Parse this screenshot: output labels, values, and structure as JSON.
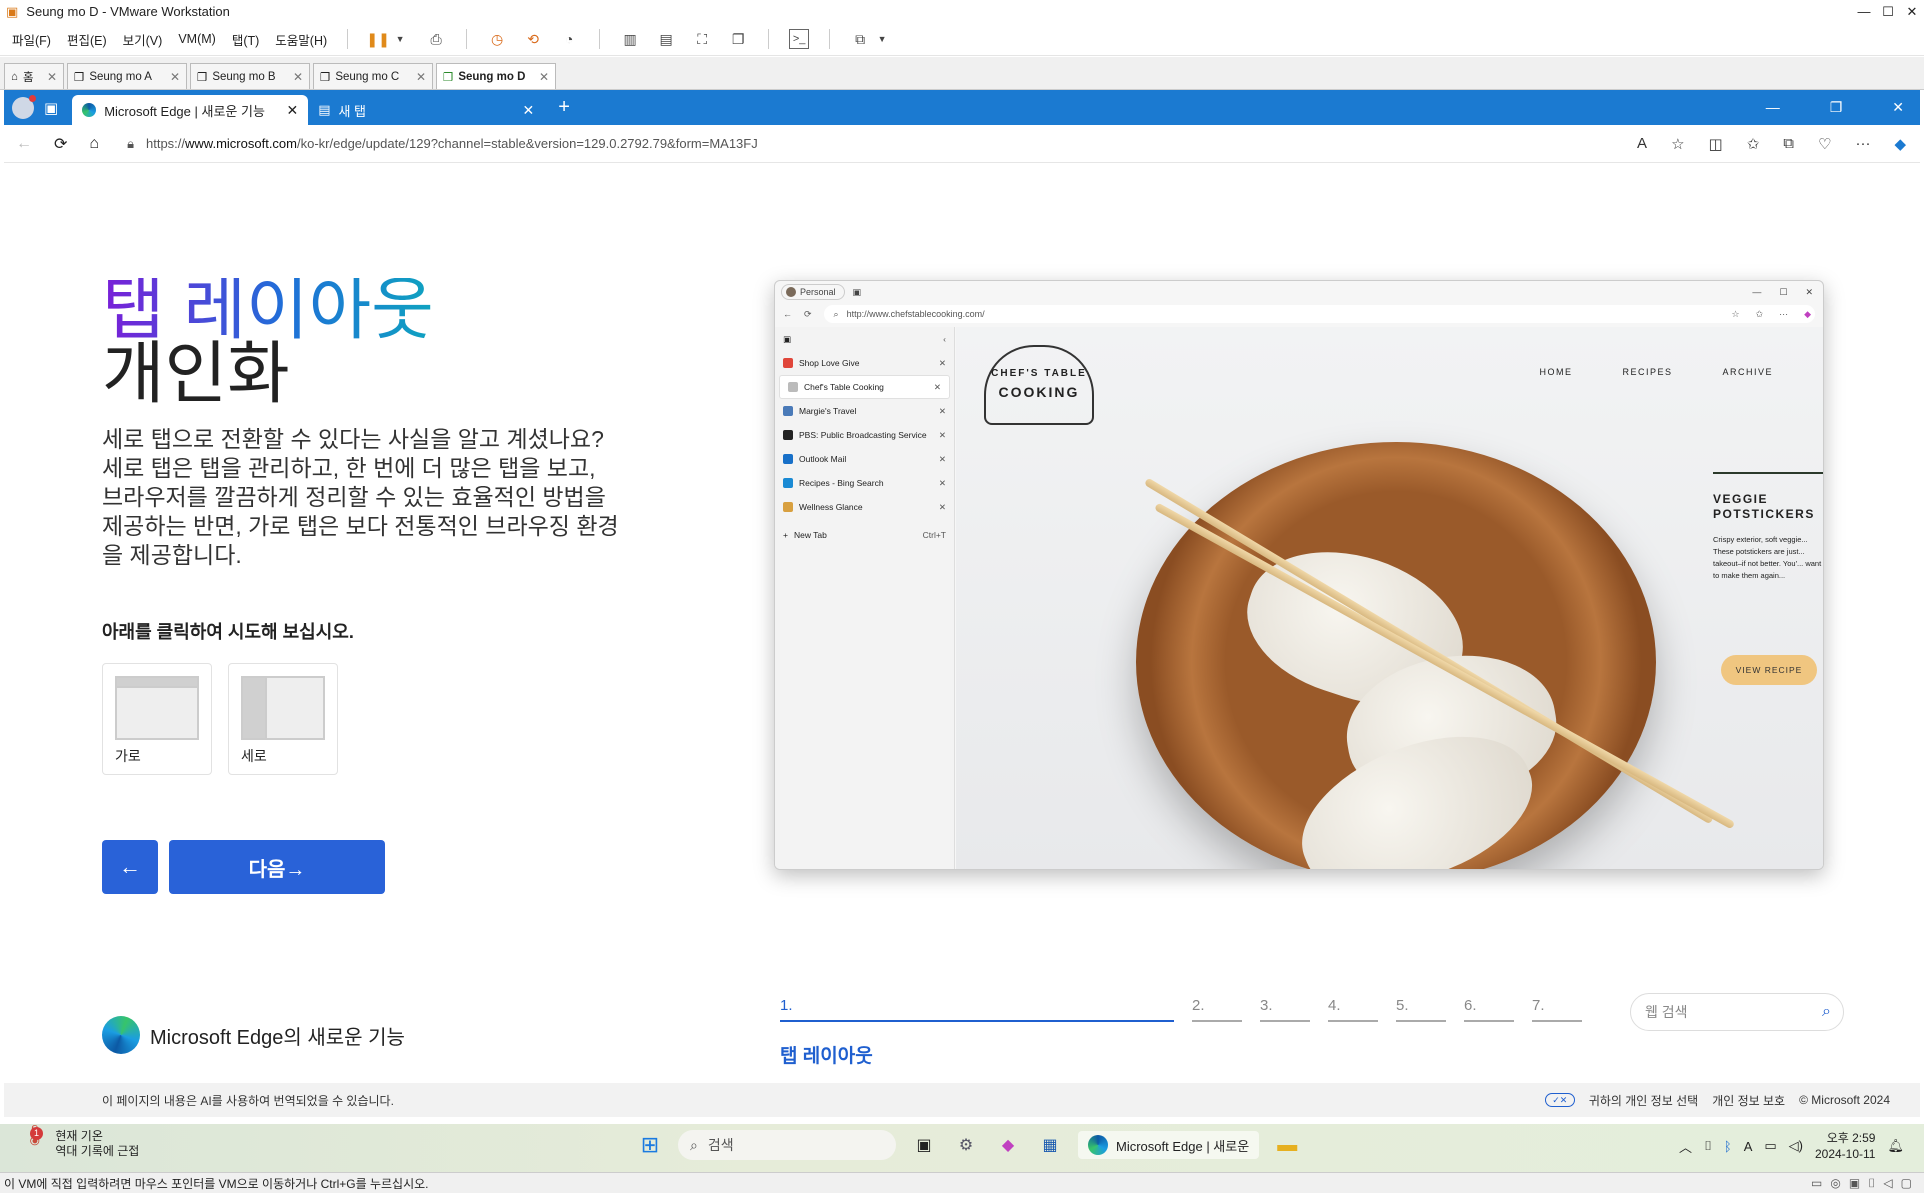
{
  "vmware": {
    "title": "Seung mo D - VMware Workstation",
    "menu": [
      "파일(F)",
      "편집(E)",
      "보기(V)",
      "VM(M)",
      "탭(T)",
      "도움말(H)"
    ],
    "tabs": [
      {
        "label": "홈"
      },
      {
        "label": "Seung mo A"
      },
      {
        "label": "Seung mo B"
      },
      {
        "label": "Seung mo C"
      },
      {
        "label": "Seung mo D"
      }
    ],
    "status_text": "이 VM에 직접 입력하려면 마우스 포인터를 VM으로 이동하거나 Ctrl+G를 누르십시오."
  },
  "edge": {
    "tabs": [
      {
        "label": "Microsoft Edge | 새로운 기능"
      },
      {
        "label": "새 탭"
      }
    ],
    "url_prefix": "https://",
    "url_host": "www.microsoft.com",
    "url_path": "/ko-kr/edge/update/129?channel=stable&version=129.0.2792.79&form=MA13FJ"
  },
  "page": {
    "title_line1": "탭 레이아웃",
    "title_line2": "개인화",
    "description": "세로 탭으로 전환할 수 있다는 사실을 알고 계셨나요? 세로 탭은 탭을 관리하고, 한 번에 더 많은 탭을 보고, 브라우저를 깔끔하게 정리할 수 있는 효율적인 방법을 제공하는 반면, 가로 탭은 보다 전통적인 브라우징 환경을 제공합니다.",
    "try_label": "아래를 클릭하여 시도해 보십시오.",
    "options": [
      "가로",
      "세로"
    ],
    "back_arrow": "←",
    "next_label": "다음→",
    "brand": "Microsoft Edge의 새로운 기능",
    "steps": [
      "1.",
      "2.",
      "3.",
      "4.",
      "5.",
      "6.",
      "7."
    ],
    "step_title": "탭 레이아웃",
    "search_placeholder": "웹 검색",
    "footer_note": "이 페이지의 내용은 AI를 사용하여 번역되었을 수 있습니다.",
    "footer_links": [
      "귀하의 개인 정보 선택",
      "개인 정보 보호",
      "© Microsoft 2024"
    ]
  },
  "mockup": {
    "profile": "Personal",
    "url": "http://www.chefstablecooking.com/",
    "vertical_tabs": [
      {
        "label": "Shop Love Give",
        "color": "#e0463a"
      },
      {
        "label": "Chef's Table Cooking",
        "color": "#bbbbbb"
      },
      {
        "label": "Margie's Travel",
        "color": "#4a7ab8"
      },
      {
        "label": "PBS: Public Broadcasting Service",
        "color": "#222222"
      },
      {
        "label": "Outlook Mail",
        "color": "#1870c8"
      },
      {
        "label": "Recipes - Bing Search",
        "color": "#1a8ad4"
      },
      {
        "label": "Wellness Glance",
        "color": "#d8a040"
      }
    ],
    "new_tab": "New Tab",
    "new_tab_shortcut": "Ctrl+T",
    "logo_line1": "CHEF'S TABLE",
    "logo_line2": "COOKING",
    "nav": [
      "HOME",
      "RECIPES",
      "ARCHIVE"
    ],
    "recipe_title": "VEGGIE POTSTICKERS",
    "recipe_desc": "Crispy exterior, soft veggie... These potstickers are just... takeout–if not better. You'... want to make them again...",
    "view_button": "VIEW RECIPE"
  },
  "taskbar": {
    "weather_line1": "현재 기온",
    "weather_line2": "역대 기록에 근접",
    "weather_badge": "1",
    "search_placeholder": "검색",
    "edge_app_label": "Microsoft Edge | 새로운",
    "time": "오후 2:59",
    "date": "2024-10-11"
  }
}
